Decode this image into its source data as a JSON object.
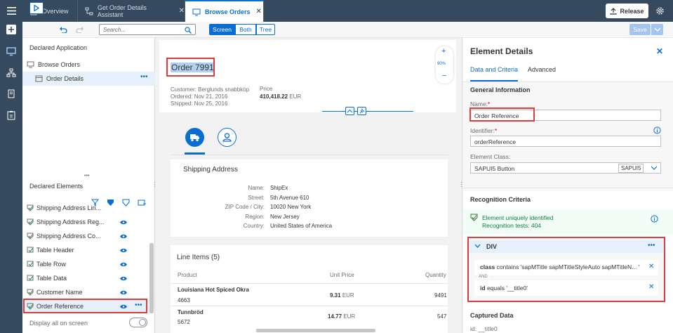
{
  "tabs": [
    {
      "label": "Overview"
    },
    {
      "label": "Get Order Details Assistant"
    },
    {
      "label": "Browse Orders"
    }
  ],
  "header": {
    "release": "Release"
  },
  "toolbar": {
    "search_placeholder": "Search...",
    "seg_screen": "Screen",
    "seg_both": "Both",
    "seg_tree": "Tree",
    "save": "Save"
  },
  "left": {
    "declared_app_title": "Declared Application",
    "app_tree": [
      {
        "label": "Browse Orders"
      },
      {
        "label": "Order Details"
      }
    ],
    "declared_elements_title": "Declared Elements",
    "elements": [
      {
        "label": "Shipping Address Lin..."
      },
      {
        "label": "Shipping Address Reg..."
      },
      {
        "label": "Shipping Address Co..."
      },
      {
        "label": "Table Header"
      },
      {
        "label": "Table Row"
      },
      {
        "label": "Table Data"
      },
      {
        "label": "Customer Name"
      },
      {
        "label": "Order Reference"
      }
    ],
    "display_all": "Display all on screen"
  },
  "preview": {
    "title": "Order 7991",
    "customer": "Customer: Berglunds snabbköp",
    "ordered": "Ordered: Nov 21, 2016",
    "shipped": "Shipped: Nov 25, 2016",
    "price_label": "Price",
    "price_value": "410,418.22",
    "price_currency": "EUR",
    "zoom": "90%",
    "shipping_title": "Shipping Address",
    "address": [
      {
        "k": "Name:",
        "v": "ShipEx"
      },
      {
        "k": "Street:",
        "v": "5th Avenue 610"
      },
      {
        "k": "ZIP Code / City:",
        "v": "10020 New York"
      },
      {
        "k": "Region:",
        "v": "New Jersey"
      },
      {
        "k": "Country:",
        "v": "United States of America"
      }
    ],
    "lineitems_title": "Line Items (5)",
    "col_product": "Product",
    "col_unit_price": "Unit Price",
    "col_quantity": "Quantity",
    "rows": [
      {
        "product": "Louisiana Hot Spiced Okra",
        "id": "4663",
        "price": "9.31",
        "cur": "EUR",
        "qty": "9491"
      },
      {
        "product": "Tunnbröd",
        "id": "5672",
        "price": "14.77",
        "cur": "EUR",
        "qty": "547"
      }
    ]
  },
  "details": {
    "title": "Element Details",
    "tab_data": "Data and Criteria",
    "tab_advanced": "Advanced",
    "general_info": "General Information",
    "name_label": "Name:",
    "name_value": "Order Reference",
    "identifier_label": "Identifier:",
    "identifier_value": "orderReference",
    "class_label": "Element Class:",
    "class_value": "SAPUI5 Button",
    "class_badge": "SAPUI5",
    "recognition": "Recognition Criteria",
    "unique": "Element uniquely identified",
    "tests": "Recognition tests: 404",
    "div_label": "DIV",
    "crit1_key": "class",
    "crit1_text": "contains 'sapMTitle sapMTitleStyleAuto sapMTitleN... '",
    "and_label": "AND",
    "crit2_key": "id",
    "crit2_text": "equals '__title0'",
    "captured": "Captured Data",
    "captured_id": "id: __title0"
  }
}
